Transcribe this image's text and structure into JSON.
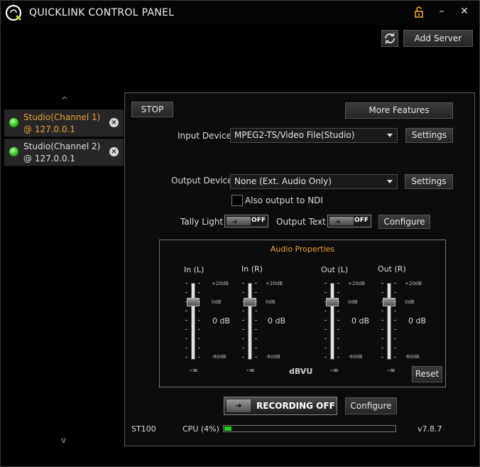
{
  "app": {
    "title": "QUICKLINK CONTROL PANEL",
    "lock_icon": "lock-icon",
    "minimize_glyph": "–",
    "close_glyph": "✕"
  },
  "toolbar": {
    "add_server_label": "Add Server",
    "refresh_icon": "refresh-icon"
  },
  "sidebar": {
    "up_arrow": "^",
    "down_arrow": "v",
    "channels": [
      {
        "name": "Studio(Channel 1)",
        "ip": "@ 127.0.0.1",
        "status": "online",
        "selected": true,
        "name_color": "#f0a030"
      },
      {
        "name": "Studio(Channel 2)",
        "ip": "@ 127.0.0.1",
        "status": "online",
        "selected": false,
        "name_color": "#dcdcdc"
      }
    ]
  },
  "panel": {
    "stop_label": "STOP",
    "more_features_label": "More Features",
    "input_device_label": "Input Device",
    "input_device_value": "MPEG2-TS/Video File(Studio)",
    "input_settings_label": "Settings",
    "output_device_label": "Output Device",
    "output_device_value": "None (Ext. Audio Only)",
    "output_settings_label": "Settings",
    "ndi_label": "Also output to NDI",
    "ndi_checked": false,
    "tally_light_label": "Tally Light",
    "tally_state": "OFF",
    "output_text_label": "Output Text",
    "output_text_state": "OFF",
    "configure_label": "Configure"
  },
  "audio": {
    "title": "Audio Properties",
    "unit_label": "dBVU",
    "reset_label": "Reset",
    "scale": {
      "top": "+20dB",
      "mid": "0dB",
      "bottom": "-60dB"
    },
    "faders": [
      {
        "label": "In (L)",
        "value_text": "0 dB",
        "peak": "-∞"
      },
      {
        "label": "In (R)",
        "value_text": "0 dB",
        "peak": "-∞"
      },
      {
        "label": "Out (L)",
        "value_text": "0 dB",
        "peak": "-∞"
      },
      {
        "label": "Out (R)",
        "value_text": "0 dB",
        "peak": "-∞"
      }
    ]
  },
  "recording": {
    "label": "RECORDING OFF",
    "configure_label": "Configure"
  },
  "status": {
    "device": "ST100",
    "cpu_label": "CPU (4%)",
    "cpu_percent": 4,
    "version": "v7.8.7",
    "accent_color": "#f0a030",
    "cpu_bar_color": "#1ed21e"
  }
}
